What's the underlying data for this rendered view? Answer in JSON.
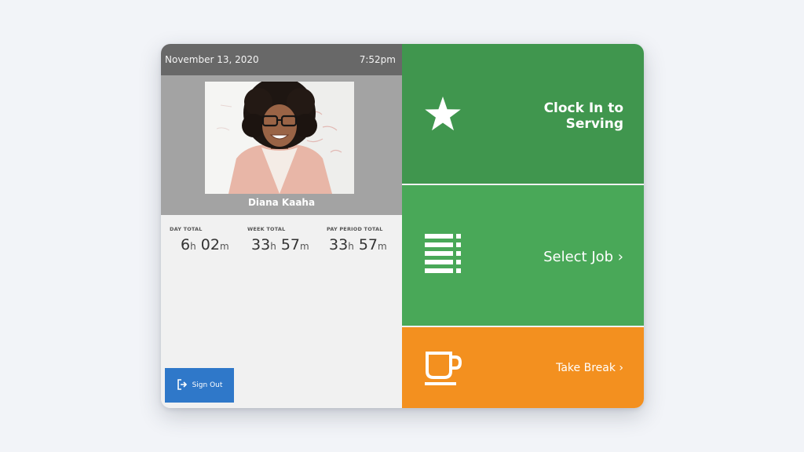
{
  "header": {
    "date": "November 13, 2020",
    "time": "7:52pm"
  },
  "employee": {
    "name": "Diana Kaaha"
  },
  "totals": [
    {
      "label": "DAY TOTAL",
      "hours": "6",
      "minutes": "02"
    },
    {
      "label": "WEEK TOTAL",
      "hours": "33",
      "minutes": "57"
    },
    {
      "label": "PAY PERIOD TOTAL",
      "hours": "33",
      "minutes": "57"
    }
  ],
  "units": {
    "hours": "h",
    "minutes": "m"
  },
  "sign_out": {
    "label": "Sign Out"
  },
  "actions": {
    "clock_in": {
      "line1": "Clock In to",
      "line2": "Serving",
      "icon": "star-icon"
    },
    "select_job": {
      "label": "Select Job ›",
      "icon": "list-icon"
    },
    "take_break": {
      "label": "Take Break ›",
      "icon": "coffee-cup-icon"
    }
  },
  "colors": {
    "header_bar": "#686868",
    "profile_bg": "#a3a3a3",
    "clock_in": "#40964e",
    "select_job": "#49a858",
    "take_break": "#f3901f",
    "sign_out": "#2f78c9"
  }
}
